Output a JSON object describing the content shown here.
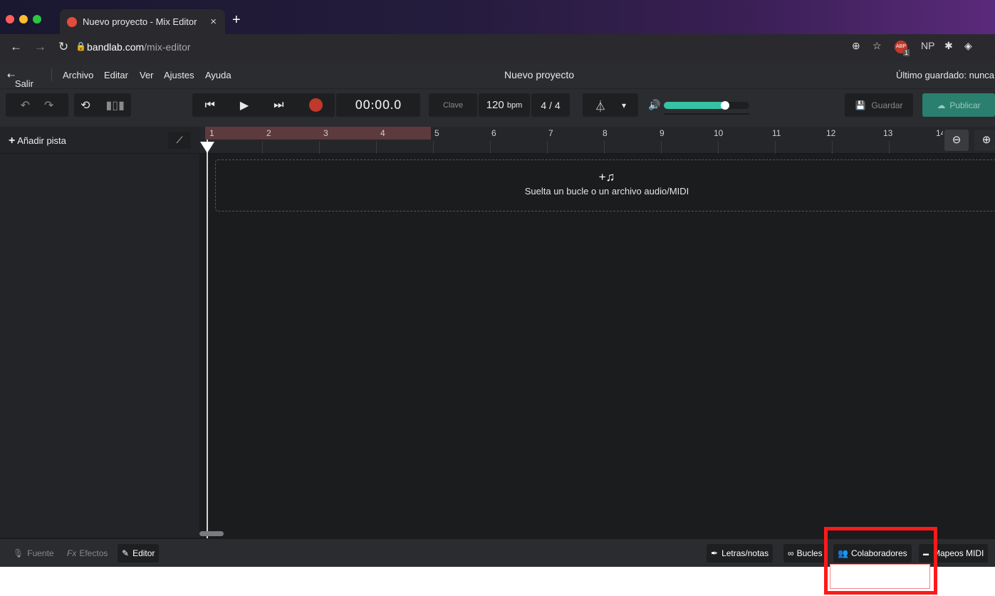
{
  "browser": {
    "tab_title": "Nuevo proyecto - Mix Editor",
    "tab_close": "×",
    "new_tab": "+",
    "url_host": "bandlab.com",
    "url_path": "/mix-editor",
    "ext_np": "NP",
    "ext_abp_badge": "1"
  },
  "menu": {
    "exit": "Salir",
    "items": [
      "Archivo",
      "Editar",
      "Ver",
      "Ajustes",
      "Ayuda"
    ],
    "project_title": "Nuevo proyecto",
    "last_saved": "Último guardado: nunca"
  },
  "transport": {
    "time": "00:00.0",
    "key_label": "Clave",
    "bpm_value": "120",
    "bpm_unit": "bpm",
    "time_signature": "4 / 4",
    "volume_level": 0.72,
    "save_label": "Guardar",
    "publish_label": "Publicar"
  },
  "sidebar": {
    "add_track": "Añadir pista"
  },
  "ruler": {
    "bars": [
      "1",
      "2",
      "3",
      "4",
      "5",
      "6",
      "7",
      "8",
      "9",
      "10",
      "11",
      "12",
      "13",
      "14"
    ]
  },
  "dropzone": {
    "text": "Suelta un bucle o un archivo audio/MIDI"
  },
  "bottom": {
    "source": "Fuente",
    "effects_prefix": "Fx",
    "effects": "Efectos",
    "editor": "Editor",
    "lyrics": "Letras/notas",
    "loops": "Bucles",
    "collaborators": "Colaboradores",
    "midi_mapping": "Mapeos MIDI"
  },
  "colors": {
    "accent": "#35c2a5",
    "publish": "#2a7f6e",
    "record": "#c0392b",
    "highlight": "#ff1a1a"
  }
}
